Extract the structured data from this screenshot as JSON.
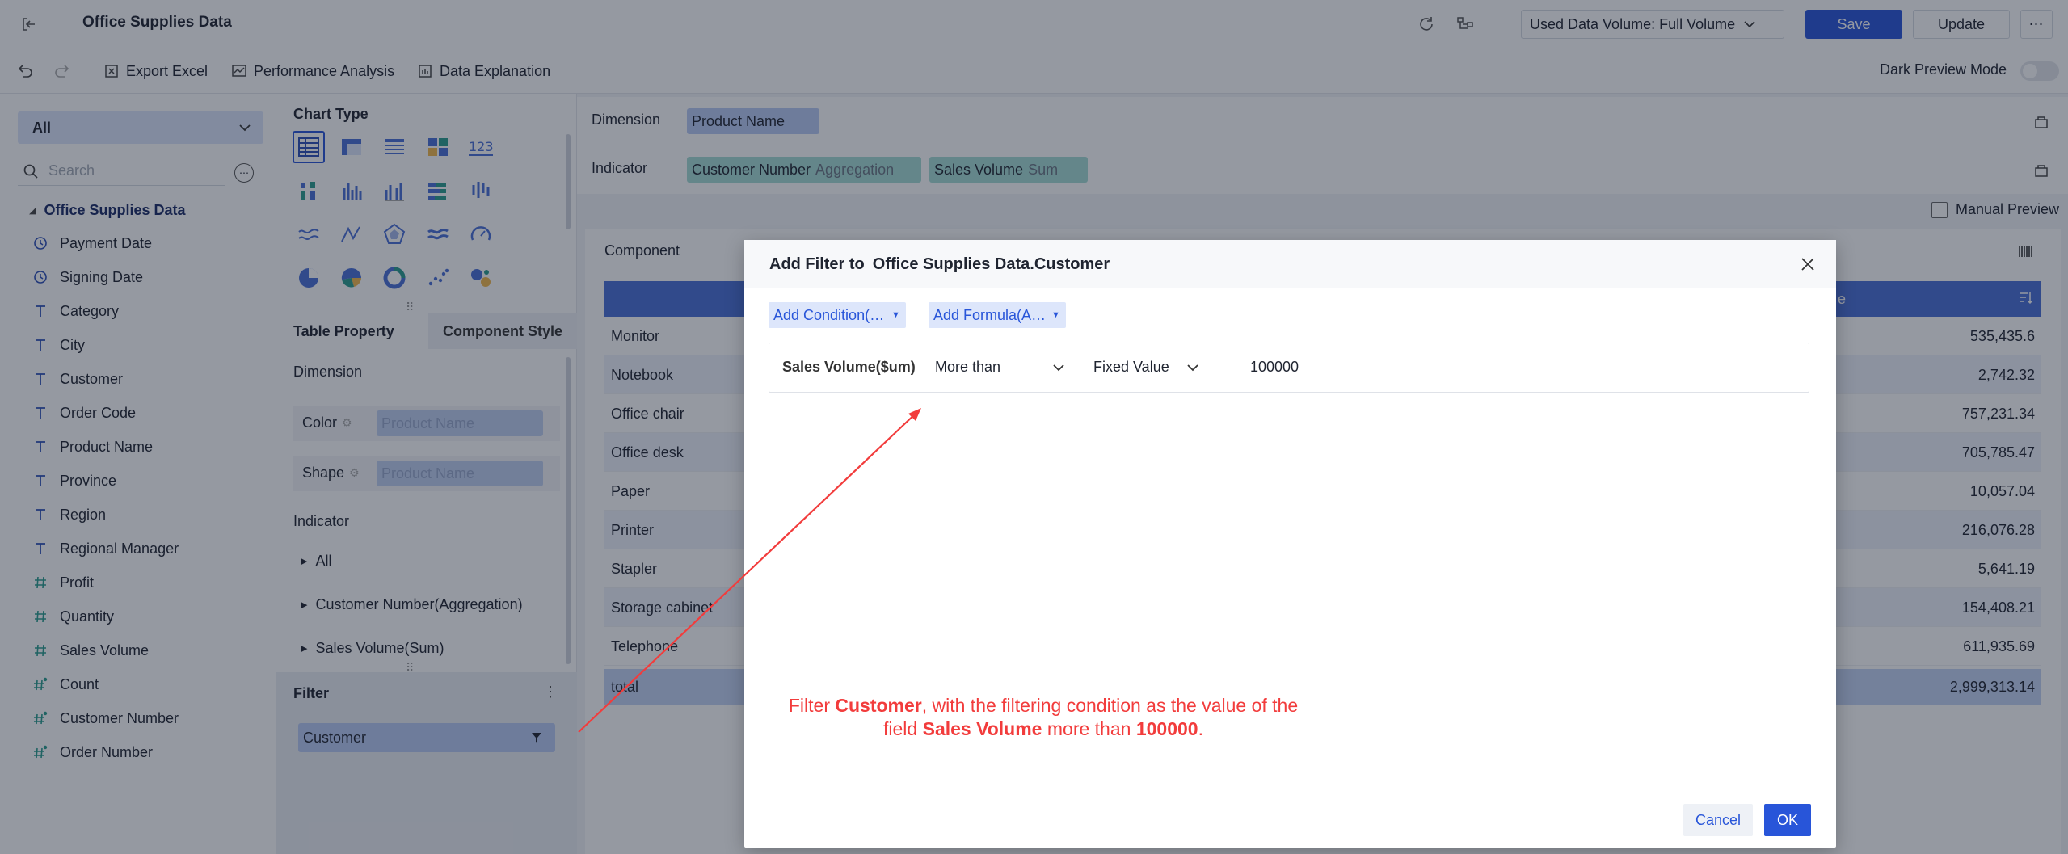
{
  "header": {
    "title": "Office Supplies Data",
    "data_volume": "Used Data Volume: Full Volume",
    "save_label": "Save",
    "update_label": "Update"
  },
  "toolbar": {
    "export_excel": "Export Excel",
    "performance_analysis": "Performance Analysis",
    "data_explanation": "Data Explanation",
    "dark_preview_mode": "Dark Preview Mode"
  },
  "left": {
    "select_value": "All",
    "search_placeholder": "Search",
    "dataset_name": "Office Supplies Data",
    "fields": [
      {
        "label": "Payment Date",
        "icon": "clock-icon"
      },
      {
        "label": "Signing Date",
        "icon": "clock-icon"
      },
      {
        "label": "Category",
        "icon": "text-icon"
      },
      {
        "label": "City",
        "icon": "text-icon"
      },
      {
        "label": "Customer",
        "icon": "text-icon"
      },
      {
        "label": "Order Code",
        "icon": "text-icon"
      },
      {
        "label": "Product Name",
        "icon": "text-icon"
      },
      {
        "label": "Province",
        "icon": "text-icon"
      },
      {
        "label": "Region",
        "icon": "text-icon"
      },
      {
        "label": "Regional Manager",
        "icon": "text-icon"
      },
      {
        "label": "Profit",
        "icon": "number-icon"
      },
      {
        "label": "Quantity",
        "icon": "number-icon"
      },
      {
        "label": "Sales Volume",
        "icon": "number-icon"
      },
      {
        "label": "Count",
        "icon": "calc-number-icon"
      },
      {
        "label": "Customer Number",
        "icon": "calc-number-icon"
      },
      {
        "label": "Order Number",
        "icon": "calc-number-icon"
      }
    ]
  },
  "mid": {
    "chart_type_label": "Chart Type",
    "tab_table_property": "Table Property",
    "tab_component_style": "Component Style",
    "dimension_label": "Dimension",
    "color_label": "Color",
    "color_placeholder": "Product Name",
    "shape_label": "Shape",
    "shape_placeholder": "Product Name",
    "indicator_label": "Indicator",
    "indicator_items": [
      "All",
      "Customer Number(Aggregation)",
      "Sales Volume(Sum)"
    ],
    "filter_label": "Filter",
    "filter_item": "Customer"
  },
  "main": {
    "dimension_label": "Dimension",
    "dimension_pill": "Product Name",
    "indicator_label": "Indicator",
    "indicator_pill1_name": "Customer Number",
    "indicator_pill1_agg": "Aggregation",
    "indicator_pill2_name": "Sales Volume",
    "indicator_pill2_agg": "Sum",
    "manual_preview": "Manual Preview",
    "component_label": "Component",
    "header_partial": "e",
    "rows": [
      {
        "name": "Monitor",
        "value": "535,435.6"
      },
      {
        "name": "Notebook",
        "value": "2,742.32"
      },
      {
        "name": "Office chair",
        "value": "757,231.34"
      },
      {
        "name": "Office desk",
        "value": "705,785.47"
      },
      {
        "name": "Paper",
        "value": "10,057.04"
      },
      {
        "name": "Printer",
        "value": "216,076.28"
      },
      {
        "name": "Stapler",
        "value": "5,641.19"
      },
      {
        "name": "Storage cabinet",
        "value": "154,408.21"
      },
      {
        "name": "Telephone",
        "value": "611,935.69"
      }
    ],
    "total_label": "total",
    "total_value": "2,999,313.14"
  },
  "dialog": {
    "title_prefix": "Add Filter to",
    "title_target": "Office Supplies Data.Customer",
    "add_condition": "Add Condition(…",
    "add_formula": "Add Formula(A…",
    "cond_field": "Sales Volume($um)",
    "cond_operator": "More than",
    "cond_value_type": "Fixed Value",
    "cond_value": "100000",
    "annotation_line1_pre": "Filter ",
    "annotation_line1_bold": "Customer",
    "annotation_line1_post": ", with the filtering condition as the value of the",
    "annotation_line2_pre": "field ",
    "annotation_line2_bold1": "Sales Volume",
    "annotation_line2_mid": " more than ",
    "annotation_line2_bold2": "100000",
    "annotation_line2_post": ".",
    "cancel_label": "Cancel",
    "ok_label": "OK"
  },
  "colors": {
    "primary": "#2855d9",
    "pill_blue": "#b9cbf5",
    "pill_teal": "#a6dcd5",
    "annotation_red": "#f23c3c",
    "table_header": "#4a6fd8"
  }
}
